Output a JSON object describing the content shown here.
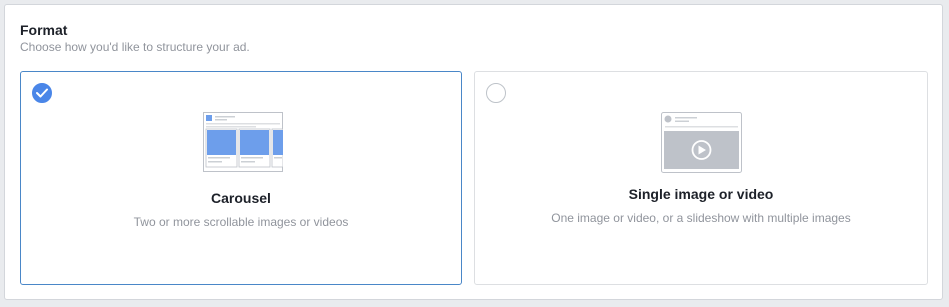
{
  "format": {
    "title": "Format",
    "subtitle": "Choose how you'd like to structure your ad.",
    "options": [
      {
        "id": "carousel",
        "label": "Carousel",
        "description": "Two or more scrollable images or videos",
        "selected": true,
        "icon": "carousel-preview-icon"
      },
      {
        "id": "single",
        "label": "Single image or video",
        "description": "One image or video, or a slideshow with multiple images",
        "selected": false,
        "icon": "single-video-preview-icon"
      }
    ]
  },
  "colors": {
    "accent": "#4a86e8",
    "selected_border": "#4a87c8",
    "muted_text": "#90949c",
    "preview_gray": "#bec2c9"
  }
}
